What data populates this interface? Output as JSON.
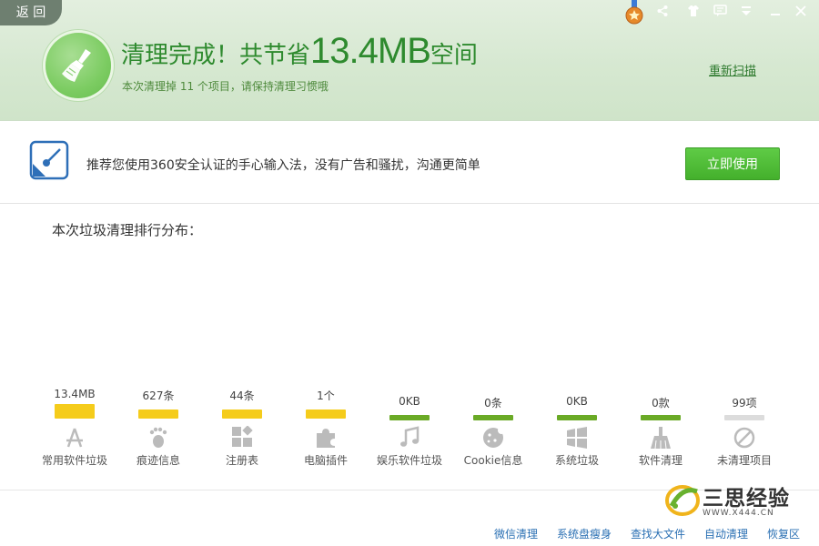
{
  "header": {
    "back_label": "返 回",
    "headline_prefix": "清理完成！共节省",
    "headline_amount": "13.4MB",
    "headline_suffix": "空间",
    "subline": "本次清理掉 11 个项目，请保持清理习惯哦",
    "rescan_label": "重新扫描"
  },
  "window_controls": [
    "medal-icon",
    "share-icon",
    "skin-icon",
    "feedback-icon",
    "menu-icon",
    "minimize-icon",
    "close-icon"
  ],
  "promo": {
    "text": "推荐您使用360安全认证的手心输入法，没有广告和骚扰，沟通更简单",
    "button_label": "立即使用"
  },
  "ranking": {
    "title": "本次垃圾清理排行分布：",
    "categories": [
      {
        "label": "常用软件垃圾",
        "value": "13.4MB",
        "level": 1.0,
        "color": "#f5cc1b",
        "icon": "app-store-icon"
      },
      {
        "label": "痕迹信息",
        "value": "627条",
        "level": 0.6,
        "color": "#f5cc1b",
        "icon": "footprint-icon"
      },
      {
        "label": "注册表",
        "value": "44条",
        "level": 0.6,
        "color": "#f5cc1b",
        "icon": "registry-blocks-icon"
      },
      {
        "label": "电脑插件",
        "value": "1个",
        "level": 0.6,
        "color": "#f5cc1b",
        "icon": "puzzle-icon"
      },
      {
        "label": "娱乐软件垃圾",
        "value": "0KB",
        "level": 0.0,
        "color": "#6aaa26",
        "icon": "music-note-icon"
      },
      {
        "label": "Cookie信息",
        "value": "0条",
        "level": 0.0,
        "color": "#6aaa26",
        "icon": "cookie-icon"
      },
      {
        "label": "系统垃圾",
        "value": "0KB",
        "level": 0.0,
        "color": "#6aaa26",
        "icon": "windows-logo-icon"
      },
      {
        "label": "软件清理",
        "value": "0款",
        "level": 0.0,
        "color": "#6aaa26",
        "icon": "broom-icon"
      },
      {
        "label": "未清理项目",
        "value": "99项",
        "level": 0.0,
        "color": "#dcdcdc",
        "icon": "no-entry-icon"
      }
    ]
  },
  "footer": {
    "links": [
      "微信清理",
      "系统盘瘦身",
      "查找大文件",
      "自动清理",
      "恢复区"
    ]
  },
  "watermark": {
    "text": "三思经验",
    "subtext": "WWW.X444.CN"
  },
  "colors": {
    "accent_green": "#2e8a2e",
    "button_green": "#44b02c",
    "link_blue": "#2a6fb3",
    "bar_yellow": "#f5cc1b"
  }
}
